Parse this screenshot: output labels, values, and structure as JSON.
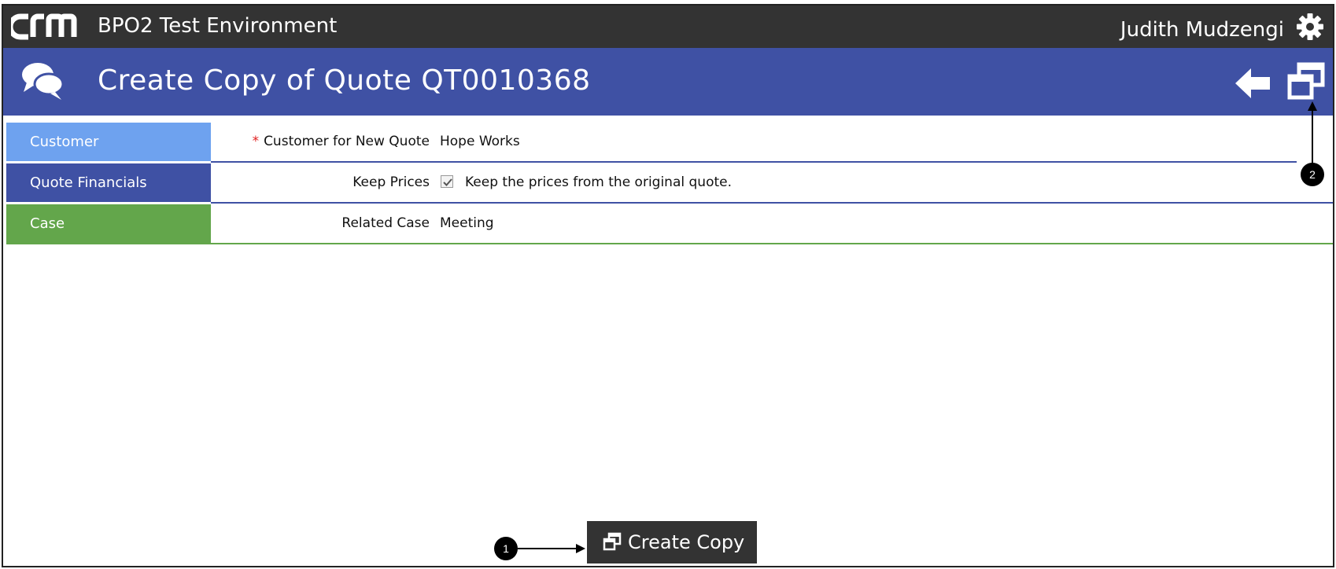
{
  "topbar": {
    "environment_title": "BPO2 Test Environment",
    "user_name": "Judith Mudzengi",
    "logo_icon": "crm-logo-icon",
    "settings_icon": "gear-icon"
  },
  "header": {
    "title": "Create Copy of Quote QT0010368",
    "section_icon": "chat-bubbles-icon",
    "back_icon": "back-arrow-icon",
    "copy_icon": "copy-windows-icon",
    "color": "#3f51a4"
  },
  "form": {
    "rows": [
      {
        "section": "Customer",
        "section_color": "#6ea2ef",
        "required_marker": "*",
        "label": "Customer for New Quote",
        "value": "Hope Works"
      },
      {
        "section": "Quote Financials",
        "section_color": "#3f51a4",
        "label": "Keep Prices",
        "checked": true,
        "value": "Keep the prices from the original quote."
      },
      {
        "section": "Case",
        "section_color": "#63a64b",
        "label": "Related Case",
        "value": "Meeting"
      }
    ]
  },
  "actions": {
    "create_copy_label": "Create Copy",
    "create_copy_icon": "copy-windows-icon"
  },
  "callouts": {
    "one": "1",
    "two": "2"
  }
}
